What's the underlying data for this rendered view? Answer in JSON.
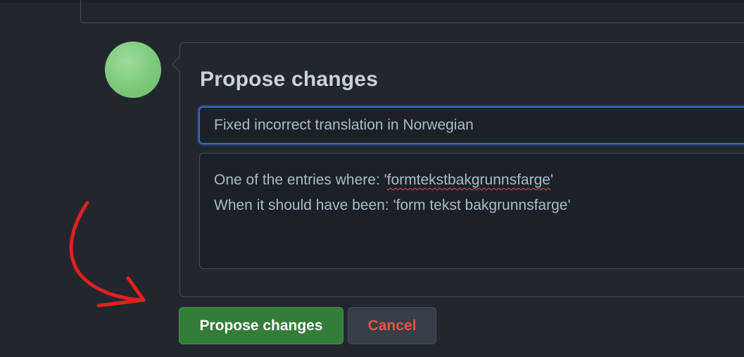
{
  "form": {
    "heading": "Propose changes",
    "title_value": "Fixed incorrect translation in Norwegian",
    "body_line1_prefix": "One of the entries where: '",
    "body_line1_word": "formtekstbakgrunnsfarge",
    "body_line1_suffix": "'",
    "body_line2": "When it should have been: 'form tekst bakgrunnsfarge'"
  },
  "actions": {
    "propose_label": "Propose changes",
    "cancel_label": "Cancel"
  },
  "colors": {
    "background": "#22272e",
    "primary_button": "#347d39",
    "cancel_text": "#e5534b",
    "focus_ring": "#316dca",
    "annotation_arrow": "#e02020"
  },
  "icons": {
    "avatar": "avatar-image",
    "annotation": "red-arrow-icon"
  }
}
